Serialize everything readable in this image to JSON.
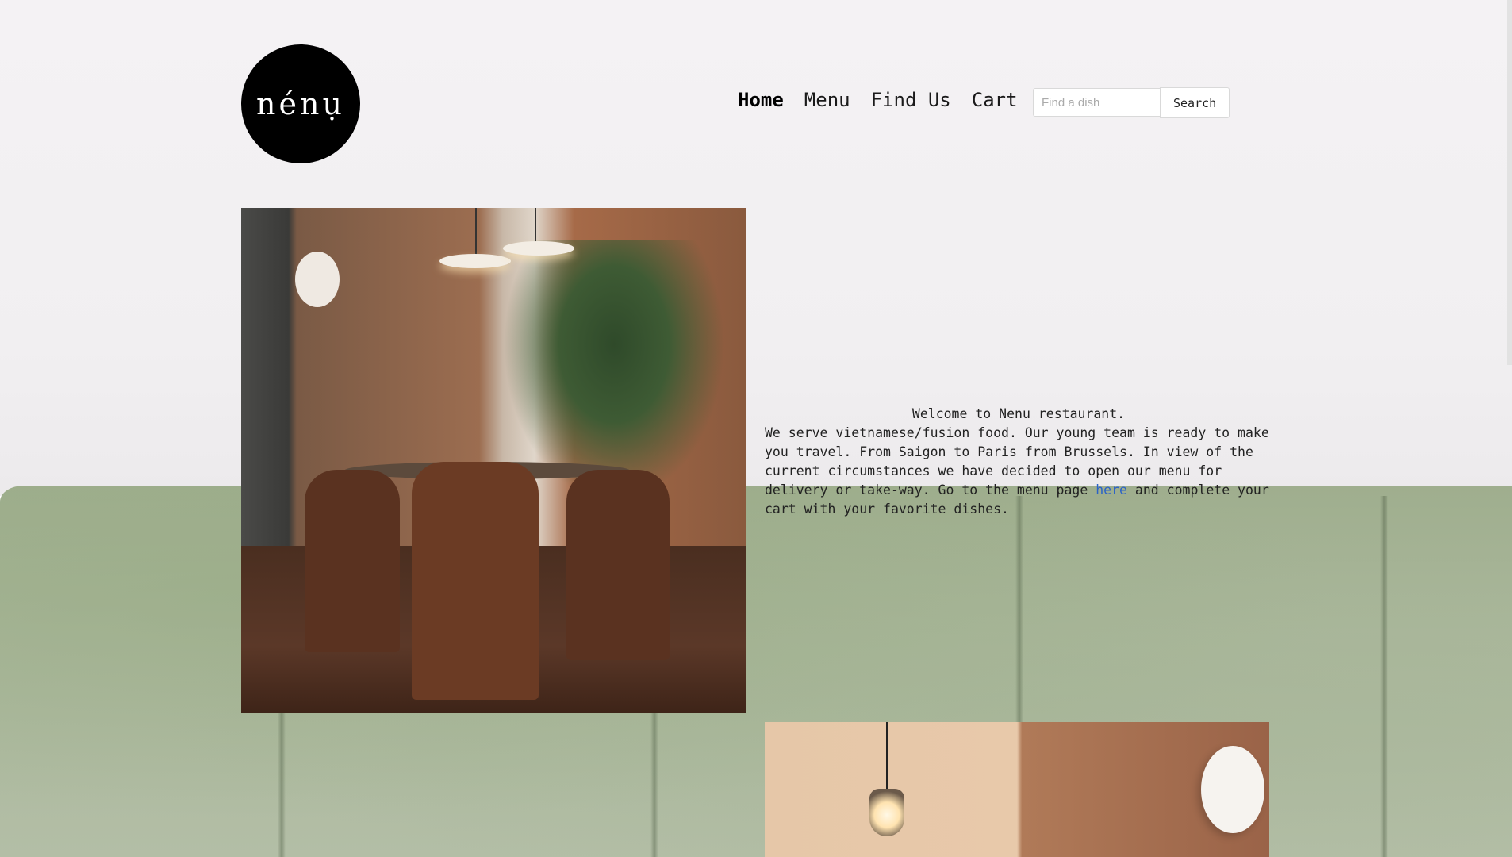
{
  "brand": {
    "logo_text": "nénụ"
  },
  "nav": {
    "items": [
      {
        "label": "Home",
        "active": true
      },
      {
        "label": "Menu",
        "active": false
      },
      {
        "label": "Find Us",
        "active": false
      },
      {
        "label": "Cart",
        "active": false
      }
    ]
  },
  "search": {
    "placeholder": "Find a dish",
    "value": "",
    "button_label": "Search"
  },
  "intro": {
    "welcome": "Welcome to Nenu restaurant.",
    "text_before_link": "We serve vietnamese/fusion food. Our young team is ready to make you travel. From Saigon to Paris from Brussels. In view of the current circumstances we have decided to open our menu for delivery or take-way. Go to the menu page ",
    "link_label": "here",
    "text_after_link": " and complete your cart with your favorite dishes."
  },
  "colors": {
    "link": "#2a62c8",
    "logo_bg": "#000000",
    "bench_green": "#aab79b"
  }
}
